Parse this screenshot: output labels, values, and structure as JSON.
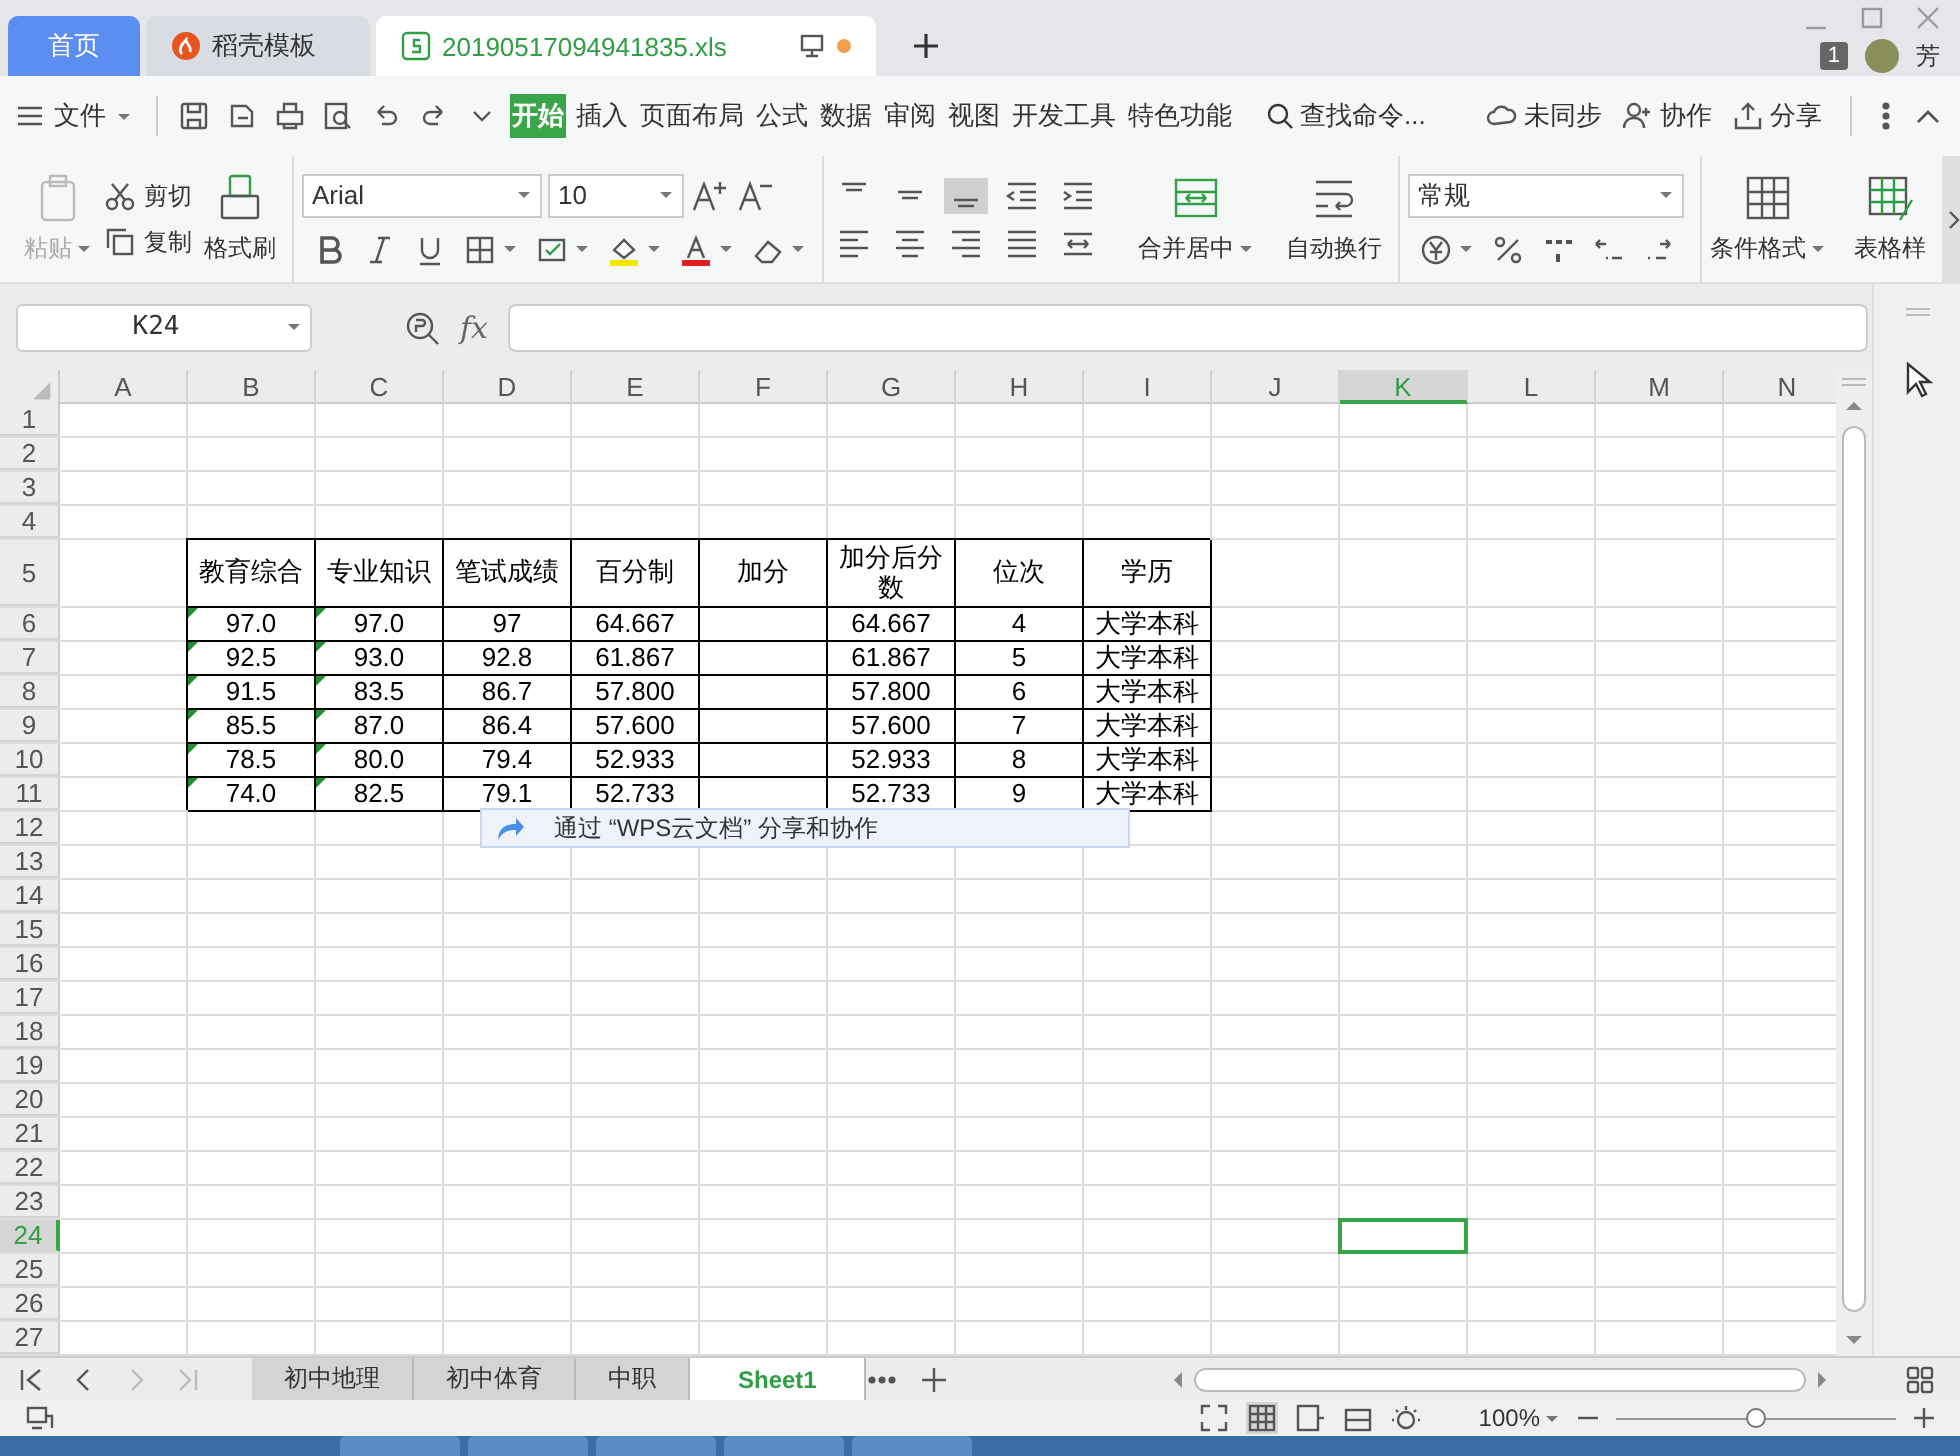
{
  "tabs": [
    {
      "label": "首页",
      "kind": "home",
      "selected": false,
      "modified": false
    },
    {
      "label": "稻壳模板",
      "kind": "docer",
      "selected": false,
      "modified": false
    },
    {
      "label": "20190517094941835.xls",
      "kind": "file",
      "selected": true,
      "modified": true
    }
  ],
  "window": {
    "badge": "1",
    "user": "芳"
  },
  "menu": {
    "file": "文件",
    "tabs": [
      {
        "label": "开始",
        "selected": true
      },
      {
        "label": "插入",
        "selected": false
      },
      {
        "label": "页面布局",
        "selected": false
      },
      {
        "label": "公式",
        "selected": false
      },
      {
        "label": "数据",
        "selected": false
      },
      {
        "label": "审阅",
        "selected": false
      },
      {
        "label": "视图",
        "selected": false
      },
      {
        "label": "开发工具",
        "selected": false
      },
      {
        "label": "特色功能",
        "selected": false
      }
    ],
    "search": "查找命令...",
    "actions": [
      "未同步",
      "协作",
      "分享"
    ]
  },
  "ribbon": {
    "paste": {
      "label": "粘贴",
      "disabled": true
    },
    "cut": "剪切",
    "copy": "复制",
    "format_painter": "格式刷",
    "font": "Arial",
    "font_size": "10",
    "vertical_align": [
      {
        "selected": false
      },
      {
        "selected": false
      },
      {
        "selected": true
      }
    ],
    "merge": "合并居中",
    "wrap": "自动换行",
    "number_format": "常规",
    "conditional_format": "条件格式",
    "table_style": "表格样"
  },
  "formula_bar": {
    "name_box": "K24",
    "fx": "fx"
  },
  "sheet": {
    "columns": [
      {
        "label": "A",
        "selected": false
      },
      {
        "label": "B",
        "selected": false
      },
      {
        "label": "C",
        "selected": false
      },
      {
        "label": "D",
        "selected": false
      },
      {
        "label": "E",
        "selected": false
      },
      {
        "label": "F",
        "selected": false
      },
      {
        "label": "G",
        "selected": false
      },
      {
        "label": "H",
        "selected": false
      },
      {
        "label": "I",
        "selected": false
      },
      {
        "label": "J",
        "selected": false
      },
      {
        "label": "K",
        "selected": true
      },
      {
        "label": "L",
        "selected": false
      },
      {
        "label": "M",
        "selected": false
      },
      {
        "label": "N",
        "selected": false
      }
    ],
    "rows": [
      {
        "number": "1",
        "kind": "empty",
        "selected": false
      },
      {
        "number": "2",
        "kind": "empty",
        "selected": false
      },
      {
        "number": "3",
        "kind": "empty",
        "selected": false
      },
      {
        "number": "4",
        "kind": "empty",
        "selected": false
      },
      {
        "number": "5",
        "kind": "header",
        "selected": false,
        "cells": [
          {
            "text": "教育综合"
          },
          {
            "text": "专业知识"
          },
          {
            "text": "笔试成绩"
          },
          {
            "text": "百分制"
          },
          {
            "text": "加分"
          },
          {
            "text": "加分后分数"
          },
          {
            "text": "位次"
          },
          {
            "text": "学历"
          }
        ]
      },
      {
        "number": "6",
        "kind": "data",
        "selected": false,
        "cells": [
          {
            "text": "97.0",
            "flag": true
          },
          {
            "text": "97.0",
            "flag": true
          },
          {
            "text": "97",
            "flag": false
          },
          {
            "text": "64.667",
            "flag": false
          },
          {
            "flag": false
          },
          {
            "text": "64.667",
            "flag": false
          },
          {
            "text": "4",
            "flag": false
          },
          {
            "text": "大学本科",
            "flag": false
          }
        ]
      },
      {
        "number": "7",
        "kind": "data",
        "selected": false,
        "cells": [
          {
            "text": "92.5",
            "flag": true
          },
          {
            "text": "93.0",
            "flag": true
          },
          {
            "text": "92.8",
            "flag": false
          },
          {
            "text": "61.867",
            "flag": false
          },
          {
            "flag": false
          },
          {
            "text": "61.867",
            "flag": false
          },
          {
            "text": "5",
            "flag": false
          },
          {
            "text": "大学本科",
            "flag": false
          }
        ]
      },
      {
        "number": "8",
        "kind": "data",
        "selected": false,
        "cells": [
          {
            "text": "91.5",
            "flag": true
          },
          {
            "text": "83.5",
            "flag": true
          },
          {
            "text": "86.7",
            "flag": false
          },
          {
            "text": "57.800",
            "flag": false
          },
          {
            "flag": false
          },
          {
            "text": "57.800",
            "flag": false
          },
          {
            "text": "6",
            "flag": false
          },
          {
            "text": "大学本科",
            "flag": false
          }
        ]
      },
      {
        "number": "9",
        "kind": "data",
        "selected": false,
        "cells": [
          {
            "text": "85.5",
            "flag": true
          },
          {
            "text": "87.0",
            "flag": true
          },
          {
            "text": "86.4",
            "flag": false
          },
          {
            "text": "57.600",
            "flag": false
          },
          {
            "flag": false
          },
          {
            "text": "57.600",
            "flag": false
          },
          {
            "text": "7",
            "flag": false
          },
          {
            "text": "大学本科",
            "flag": false
          }
        ]
      },
      {
        "number": "10",
        "kind": "data",
        "selected": false,
        "cells": [
          {
            "text": "78.5",
            "flag": true
          },
          {
            "text": "80.0",
            "flag": true
          },
          {
            "text": "79.4",
            "flag": false
          },
          {
            "text": "52.933",
            "flag": false
          },
          {
            "flag": false
          },
          {
            "text": "52.933",
            "flag": false
          },
          {
            "text": "8",
            "flag": false
          },
          {
            "text": "大学本科",
            "flag": false
          }
        ]
      },
      {
        "number": "11",
        "kind": "data",
        "selected": false,
        "cells": [
          {
            "text": "74.0",
            "flag": true
          },
          {
            "text": "82.5",
            "flag": true
          },
          {
            "text": "79.1",
            "flag": false
          },
          {
            "text": "52.733",
            "flag": false
          },
          {
            "flag": false
          },
          {
            "text": "52.733",
            "flag": false
          },
          {
            "text": "9",
            "flag": false
          },
          {
            "text": "大学本科",
            "flag": false
          }
        ]
      },
      {
        "number": "12",
        "kind": "empty",
        "selected": false
      },
      {
        "number": "13",
        "kind": "empty",
        "selected": false
      },
      {
        "number": "14",
        "kind": "empty",
        "selected": false
      },
      {
        "number": "15",
        "kind": "empty",
        "selected": false
      },
      {
        "number": "16",
        "kind": "empty",
        "selected": false
      },
      {
        "number": "17",
        "kind": "empty",
        "selected": false
      },
      {
        "number": "18",
        "kind": "empty",
        "selected": false
      },
      {
        "number": "19",
        "kind": "empty",
        "selected": false
      },
      {
        "number": "20",
        "kind": "empty",
        "selected": false
      },
      {
        "number": "21",
        "kind": "empty",
        "selected": false
      },
      {
        "number": "22",
        "kind": "empty",
        "selected": false
      },
      {
        "number": "23",
        "kind": "empty",
        "selected": false
      },
      {
        "number": "24",
        "kind": "empty",
        "selected": true
      },
      {
        "number": "25",
        "kind": "empty",
        "selected": false
      },
      {
        "number": "26",
        "kind": "empty",
        "selected": false
      },
      {
        "number": "27",
        "kind": "empty",
        "selected": false
      }
    ],
    "popup": {
      "text": "通过 “WPS云文档” 分享和协作"
    }
  },
  "sheet_tabs": [
    {
      "label": "初中地理",
      "selected": false
    },
    {
      "label": "初中体育",
      "selected": false
    },
    {
      "label": "中职",
      "selected": false
    },
    {
      "label": "Sheet1",
      "selected": true
    }
  ],
  "status_bar": {
    "zoom": "100%",
    "zoom_slider": {
      "level": 0.5
    }
  }
}
